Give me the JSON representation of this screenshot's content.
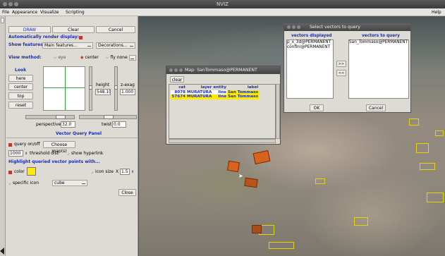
{
  "window": {
    "title": "NVIZ"
  },
  "menubar": {
    "file": "File",
    "appearance": "Appearance",
    "visualize": "Visualize",
    "scripting": "Scripting",
    "help": "Help"
  },
  "draw_panel": {
    "draw_label": "DRAW",
    "clear_label": "Clear",
    "cancel_label": "Cancel",
    "auto_render_label": "Automatically render display:",
    "show_features_label": "Show features:",
    "main_features_value": "Main features...",
    "decorations_value": "Decorations..."
  },
  "view_method": {
    "label": "View method:",
    "eye_label": "eye",
    "center_label": "center",
    "fly_label": "fly none"
  },
  "look_panel": {
    "look_label": "Look",
    "here_label": "here",
    "center_label": "center",
    "top_label": "top",
    "reset_label": "reset",
    "height_label": "height",
    "height_value": "548.1(",
    "zexag_label": "z-exag",
    "zexag_value": "1.000",
    "perspective_label": "perspective",
    "perspective_value": "32.0",
    "twist_label": "twist",
    "twist_value": "0.0"
  },
  "query_panel": {
    "title": "Vector Query Panel",
    "query_label": "query on/off",
    "choose_maps_label": "Choose map(s)",
    "threshold_value": "1000",
    "threshold_label": "threshold dist",
    "hyperlink_label": "show hyperlink",
    "highlight_label": "Highlight queried vector points with...",
    "color_label": "color",
    "color_value": "#ffea00",
    "icon_size_label": "icon size",
    "icon_size_x": "X",
    "icon_size_value": "1.5",
    "specific_icon_label": "specific icon",
    "icon_value": "cube",
    "close_label": "Close"
  },
  "map_window": {
    "title": "Map: SanTommaso@PERMANENT",
    "clear_label": "clear",
    "columns": [
      "cat",
      "layer",
      "entity",
      "label"
    ],
    "rows": [
      {
        "cat": "8078",
        "layer": "MURATURA",
        "entity": "line",
        "label": "San Tommaso"
      },
      {
        "cat": "57674",
        "layer": "MURATURA",
        "entity": "line",
        "label": "San Tommaso"
      }
    ]
  },
  "select_window": {
    "title": "Select vectors to query",
    "displayed_header": "vectors displayed",
    "query_header": "vectors to query",
    "displayed_items": [
      "p_x_3d@PERMANENT",
      "confini@PERMANENT"
    ],
    "query_items": [
      "San_Tommaso@PERMANENT"
    ],
    "add_label": ">>",
    "remove_label": "<<",
    "ok_label": "OK",
    "cancel_label": "Cancel"
  },
  "colors": {
    "accent_blue": "#1c2eb0",
    "toggle_red": "#c0392b",
    "highlight_yellow": "#ffea00"
  }
}
